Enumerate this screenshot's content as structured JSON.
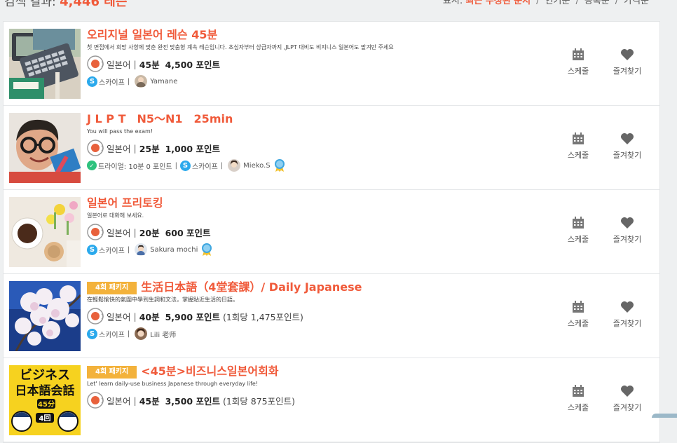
{
  "header": {
    "result_label": "검색 결과:",
    "result_count": "4,446 레슨"
  },
  "sort": {
    "label": "표시:",
    "options": [
      {
        "label": "최근 수정된 순서",
        "active": true
      },
      {
        "label": "인기순",
        "active": false
      },
      {
        "label": "등록순",
        "active": false
      },
      {
        "label": "가격순",
        "active": false
      }
    ]
  },
  "actions": {
    "schedule": "스케줄",
    "favorite": "즐겨찾기"
  },
  "lessons": [
    {
      "title": "오리지널 일본어 레슨 45분",
      "badge": "",
      "desc": "첫 면접에서 희망 사항에 맞춘 완전 맞춤형 계속 레슨입니다. 초심자부터 상급자까지 ,JLPT 대비도 비지니스 일본어도 맡겨만 주세요",
      "language": "일본어",
      "duration": "45분",
      "points": "4,500 포인트",
      "per_session": "",
      "trial": "",
      "platform": "스카이프",
      "teacher": "Yamane"
    },
    {
      "title": "J L P T　N5～N1　25min",
      "badge": "",
      "desc": "You will pass the exam!",
      "language": "일본어",
      "duration": "25분",
      "points": "1,000 포인트",
      "per_session": "",
      "trial": "트라이얼: 10분 0 포인트",
      "platform": "스카이프",
      "teacher": "Mieko.S"
    },
    {
      "title": "일본어 프리토킹",
      "badge": "",
      "desc": "일본어로 대화해 보세요.",
      "language": "일본어",
      "duration": "20분",
      "points": "600 포인트",
      "per_session": "",
      "trial": "",
      "platform": "스카이프",
      "teacher": "Sakura mochi"
    },
    {
      "title": "生活日本語（4堂套課）/ Daily Japanese",
      "badge": "4회 패키지",
      "desc": "在輕鬆愉快的氣圍中學到生詞和文法，掌握貼近生活的日語。",
      "language": "일본어",
      "duration": "40분",
      "points": "5,900 포인트",
      "per_session": "(1회당 1,475포인트)",
      "trial": "",
      "platform": "스카이프",
      "teacher": "Lili 老师"
    },
    {
      "title": "<45분>비즈니스일본어회화",
      "badge": "4회 패키지",
      "desc": "Let' learn daily-use business Japanese through everyday life!",
      "language": "일본어",
      "duration": "45분",
      "points": "3,500 포인트",
      "per_session": "(1회당 875포인트)",
      "trial": "",
      "platform": "",
      "teacher": ""
    }
  ],
  "thumb5": {
    "line1": "ビジネス",
    "line2": "日本語会話",
    "line3": "45分",
    "line4": "4回"
  },
  "colors": {
    "accent": "#f05a3a",
    "badge": "#f3b23b",
    "skype": "#2aa9ec"
  }
}
